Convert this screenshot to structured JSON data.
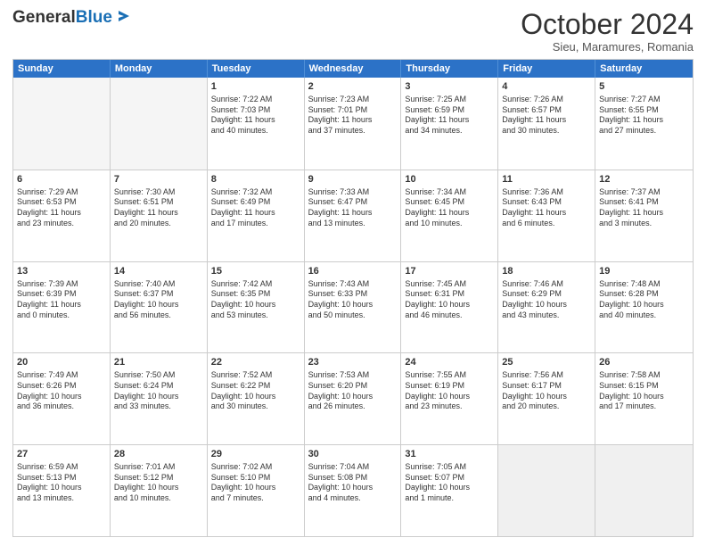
{
  "header": {
    "logo_general": "General",
    "logo_blue": "Blue",
    "month_title": "October 2024",
    "location": "Sieu, Maramures, Romania"
  },
  "calendar": {
    "days": [
      "Sunday",
      "Monday",
      "Tuesday",
      "Wednesday",
      "Thursday",
      "Friday",
      "Saturday"
    ],
    "rows": [
      [
        {
          "day": "",
          "empty": true
        },
        {
          "day": "",
          "empty": true
        },
        {
          "day": "1",
          "lines": [
            "Sunrise: 7:22 AM",
            "Sunset: 7:03 PM",
            "Daylight: 11 hours",
            "and 40 minutes."
          ]
        },
        {
          "day": "2",
          "lines": [
            "Sunrise: 7:23 AM",
            "Sunset: 7:01 PM",
            "Daylight: 11 hours",
            "and 37 minutes."
          ]
        },
        {
          "day": "3",
          "lines": [
            "Sunrise: 7:25 AM",
            "Sunset: 6:59 PM",
            "Daylight: 11 hours",
            "and 34 minutes."
          ]
        },
        {
          "day": "4",
          "lines": [
            "Sunrise: 7:26 AM",
            "Sunset: 6:57 PM",
            "Daylight: 11 hours",
            "and 30 minutes."
          ]
        },
        {
          "day": "5",
          "lines": [
            "Sunrise: 7:27 AM",
            "Sunset: 6:55 PM",
            "Daylight: 11 hours",
            "and 27 minutes."
          ]
        }
      ],
      [
        {
          "day": "6",
          "lines": [
            "Sunrise: 7:29 AM",
            "Sunset: 6:53 PM",
            "Daylight: 11 hours",
            "and 23 minutes."
          ]
        },
        {
          "day": "7",
          "lines": [
            "Sunrise: 7:30 AM",
            "Sunset: 6:51 PM",
            "Daylight: 11 hours",
            "and 20 minutes."
          ]
        },
        {
          "day": "8",
          "lines": [
            "Sunrise: 7:32 AM",
            "Sunset: 6:49 PM",
            "Daylight: 11 hours",
            "and 17 minutes."
          ]
        },
        {
          "day": "9",
          "lines": [
            "Sunrise: 7:33 AM",
            "Sunset: 6:47 PM",
            "Daylight: 11 hours",
            "and 13 minutes."
          ]
        },
        {
          "day": "10",
          "lines": [
            "Sunrise: 7:34 AM",
            "Sunset: 6:45 PM",
            "Daylight: 11 hours",
            "and 10 minutes."
          ]
        },
        {
          "day": "11",
          "lines": [
            "Sunrise: 7:36 AM",
            "Sunset: 6:43 PM",
            "Daylight: 11 hours",
            "and 6 minutes."
          ]
        },
        {
          "day": "12",
          "lines": [
            "Sunrise: 7:37 AM",
            "Sunset: 6:41 PM",
            "Daylight: 11 hours",
            "and 3 minutes."
          ]
        }
      ],
      [
        {
          "day": "13",
          "lines": [
            "Sunrise: 7:39 AM",
            "Sunset: 6:39 PM",
            "Daylight: 11 hours",
            "and 0 minutes."
          ]
        },
        {
          "day": "14",
          "lines": [
            "Sunrise: 7:40 AM",
            "Sunset: 6:37 PM",
            "Daylight: 10 hours",
            "and 56 minutes."
          ]
        },
        {
          "day": "15",
          "lines": [
            "Sunrise: 7:42 AM",
            "Sunset: 6:35 PM",
            "Daylight: 10 hours",
            "and 53 minutes."
          ]
        },
        {
          "day": "16",
          "lines": [
            "Sunrise: 7:43 AM",
            "Sunset: 6:33 PM",
            "Daylight: 10 hours",
            "and 50 minutes."
          ]
        },
        {
          "day": "17",
          "lines": [
            "Sunrise: 7:45 AM",
            "Sunset: 6:31 PM",
            "Daylight: 10 hours",
            "and 46 minutes."
          ]
        },
        {
          "day": "18",
          "lines": [
            "Sunrise: 7:46 AM",
            "Sunset: 6:29 PM",
            "Daylight: 10 hours",
            "and 43 minutes."
          ]
        },
        {
          "day": "19",
          "lines": [
            "Sunrise: 7:48 AM",
            "Sunset: 6:28 PM",
            "Daylight: 10 hours",
            "and 40 minutes."
          ]
        }
      ],
      [
        {
          "day": "20",
          "lines": [
            "Sunrise: 7:49 AM",
            "Sunset: 6:26 PM",
            "Daylight: 10 hours",
            "and 36 minutes."
          ]
        },
        {
          "day": "21",
          "lines": [
            "Sunrise: 7:50 AM",
            "Sunset: 6:24 PM",
            "Daylight: 10 hours",
            "and 33 minutes."
          ]
        },
        {
          "day": "22",
          "lines": [
            "Sunrise: 7:52 AM",
            "Sunset: 6:22 PM",
            "Daylight: 10 hours",
            "and 30 minutes."
          ]
        },
        {
          "day": "23",
          "lines": [
            "Sunrise: 7:53 AM",
            "Sunset: 6:20 PM",
            "Daylight: 10 hours",
            "and 26 minutes."
          ]
        },
        {
          "day": "24",
          "lines": [
            "Sunrise: 7:55 AM",
            "Sunset: 6:19 PM",
            "Daylight: 10 hours",
            "and 23 minutes."
          ]
        },
        {
          "day": "25",
          "lines": [
            "Sunrise: 7:56 AM",
            "Sunset: 6:17 PM",
            "Daylight: 10 hours",
            "and 20 minutes."
          ]
        },
        {
          "day": "26",
          "lines": [
            "Sunrise: 7:58 AM",
            "Sunset: 6:15 PM",
            "Daylight: 10 hours",
            "and 17 minutes."
          ]
        }
      ],
      [
        {
          "day": "27",
          "lines": [
            "Sunrise: 6:59 AM",
            "Sunset: 5:13 PM",
            "Daylight: 10 hours",
            "and 13 minutes."
          ]
        },
        {
          "day": "28",
          "lines": [
            "Sunrise: 7:01 AM",
            "Sunset: 5:12 PM",
            "Daylight: 10 hours",
            "and 10 minutes."
          ]
        },
        {
          "day": "29",
          "lines": [
            "Sunrise: 7:02 AM",
            "Sunset: 5:10 PM",
            "Daylight: 10 hours",
            "and 7 minutes."
          ]
        },
        {
          "day": "30",
          "lines": [
            "Sunrise: 7:04 AM",
            "Sunset: 5:08 PM",
            "Daylight: 10 hours",
            "and 4 minutes."
          ]
        },
        {
          "day": "31",
          "lines": [
            "Sunrise: 7:05 AM",
            "Sunset: 5:07 PM",
            "Daylight: 10 hours",
            "and 1 minute."
          ]
        },
        {
          "day": "",
          "empty": true,
          "shaded": true
        },
        {
          "day": "",
          "empty": true,
          "shaded": true
        }
      ]
    ]
  }
}
